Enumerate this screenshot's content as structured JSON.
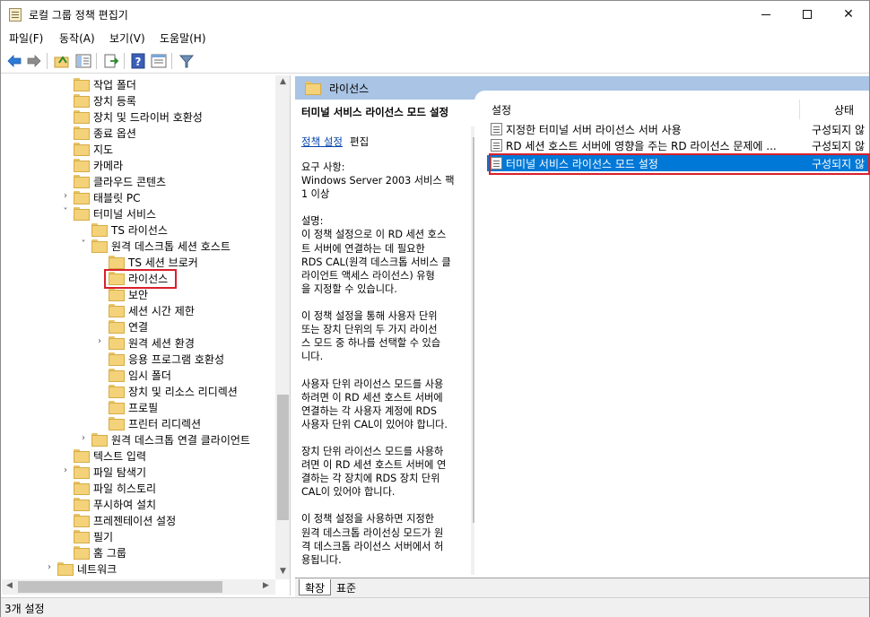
{
  "window": {
    "title": "로컬 그룹 정책 편집기"
  },
  "menu": [
    "파일(F)",
    "동작(A)",
    "보기(V)",
    "도움말(H)"
  ],
  "toolbar": [
    "back-icon",
    "forward-icon",
    "up-folder-icon",
    "show-hide-tree-icon",
    "export-list-icon",
    "help-icon",
    "properties-icon",
    "filter-icon"
  ],
  "tree": {
    "items": [
      {
        "label": "작업 폴더",
        "depth": 0,
        "expander": ""
      },
      {
        "label": "장치 등록",
        "depth": 0,
        "expander": ""
      },
      {
        "label": "장치 및 드라이버 호환성",
        "depth": 0,
        "expander": ""
      },
      {
        "label": "종료 옵션",
        "depth": 0,
        "expander": ""
      },
      {
        "label": "지도",
        "depth": 0,
        "expander": ""
      },
      {
        "label": "카메라",
        "depth": 0,
        "expander": ""
      },
      {
        "label": "클라우드 콘텐츠",
        "depth": 0,
        "expander": ""
      },
      {
        "label": "태블릿 PC",
        "depth": 0,
        "expander": "›"
      },
      {
        "label": "터미널 서비스",
        "depth": 0,
        "expander": "˅"
      },
      {
        "label": "TS 라이선스",
        "depth": 1,
        "expander": ""
      },
      {
        "label": "원격 데스크톱 세션 호스트",
        "depth": 1,
        "expander": "˅"
      },
      {
        "label": "TS 세션 브로커",
        "depth": 2,
        "expander": ""
      },
      {
        "label": "라이선스",
        "depth": 2,
        "expander": ""
      },
      {
        "label": "보안",
        "depth": 2,
        "expander": ""
      },
      {
        "label": "세션 시간 제한",
        "depth": 2,
        "expander": ""
      },
      {
        "label": "연결",
        "depth": 2,
        "expander": ""
      },
      {
        "label": "원격 세션 환경",
        "depth": 2,
        "expander": "›"
      },
      {
        "label": "응용 프로그램 호환성",
        "depth": 2,
        "expander": ""
      },
      {
        "label": "임시 폴더",
        "depth": 2,
        "expander": ""
      },
      {
        "label": "장치 및 리소스 리디렉션",
        "depth": 2,
        "expander": ""
      },
      {
        "label": "프로필",
        "depth": 2,
        "expander": ""
      },
      {
        "label": "프린터 리디렉션",
        "depth": 2,
        "expander": ""
      },
      {
        "label": "원격 데스크톱 연결 클라이언트",
        "depth": 1,
        "expander": "›"
      },
      {
        "label": "텍스트 입력",
        "depth": 0,
        "expander": ""
      },
      {
        "label": "파일 탐색기",
        "depth": 0,
        "expander": "›"
      },
      {
        "label": "파일 히스토리",
        "depth": 0,
        "expander": ""
      },
      {
        "label": "푸시하여 설치",
        "depth": 0,
        "expander": ""
      },
      {
        "label": "프레젠테이션 설정",
        "depth": 0,
        "expander": ""
      },
      {
        "label": "필기",
        "depth": 0,
        "expander": ""
      },
      {
        "label": "홈 그룹",
        "depth": 0,
        "expander": ""
      },
      {
        "label": "네트워크",
        "depth": -1,
        "expander": "›"
      }
    ]
  },
  "right": {
    "header": "라이선스",
    "description": {
      "title": "터미널 서비스 라이선스 모드 설정",
      "link": "정책 설정",
      "edit": "편집",
      "body": "요구 사항:\nWindows Server 2003 서비스 팩\n1 이상\n\n설명:\n이 정책 설정으로 이 RD 세션 호스\n트 서버에 연결하는 데 필요한\nRDS CAL(원격 데스크톱 서비스 클\n라이언트 액세스 라이선스) 유형\n을 지정할 수 있습니다.\n\n이 정책 설정을 통해 사용자 단위\n또는 장치 단위의 두 가지 라이선\n스 모드 중 하나를 선택할 수 있습\n니다.\n\n사용자 단위 라이선스 모드를 사용\n하려면 이 RD 세션 호스트 서버에\n연결하는 각 사용자 계정에 RDS\n사용자 단위 CAL이 있어야 합니다.\n\n장치 단위 라이선스 모드를 사용하\n려면 이 RD 세션 호스트 서버에 연\n결하는 각 장치에 RDS 장치 단위\nCAL이 있어야 합니다.\n\n이 정책 설정을 사용하면 지정한\n원격 데스크톱 라이선싱 모드가 원\n격 데스크톱 라이선스 서버에서 허\n용됩니다."
    },
    "columns": {
      "setting": "설정",
      "state": "상태"
    },
    "rows": [
      {
        "name": "지정한 터미널 서버 라이선스 서버 사용",
        "state": "구성되지 않"
      },
      {
        "name": "RD 세션 호스트 서버에 영향을 주는 RD 라이선스 문제에 ...",
        "state": "구성되지 않"
      },
      {
        "name": "터미널 서비스 라이선스 모드 설정",
        "state": "구성되지 않"
      }
    ],
    "tabs": [
      "확장",
      "표준"
    ]
  },
  "status": "3개 설정"
}
